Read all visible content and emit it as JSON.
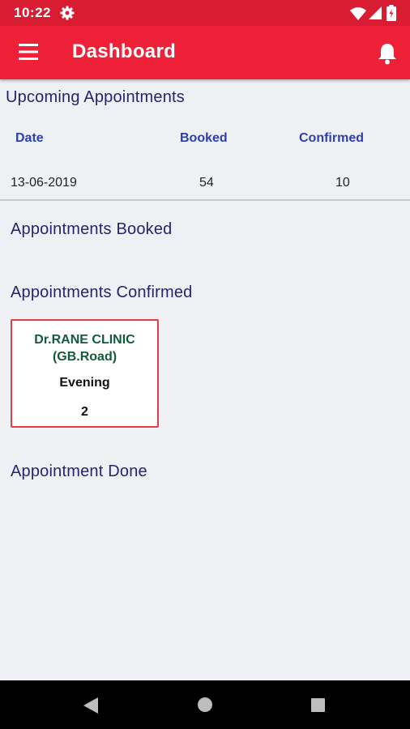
{
  "status_bar": {
    "time": "10:22"
  },
  "app_bar": {
    "title": "Dashboard"
  },
  "upcoming": {
    "title": "Upcoming Appointments",
    "columns": [
      "Date",
      "Booked",
      "Confirmed"
    ],
    "row": {
      "date": "13-06-2019",
      "booked": "54",
      "confirmed": "10"
    }
  },
  "sections": {
    "booked_title": "Appointments Booked",
    "confirmed_title": "Appointments Confirmed",
    "done_title": "Appointment Done"
  },
  "confirmed_card": {
    "clinic_line1": "Dr.RANE CLINIC",
    "clinic_line2": "(GB.Road)",
    "session": "Evening",
    "count": "2"
  },
  "colors": {
    "status_bar": "#d81d32",
    "app_bar": "#ef2139",
    "section_title": "#25256e",
    "column_header": "#2b3fae",
    "clinic_name": "#145a3c",
    "card_border": "#e23d4b"
  },
  "icons": {
    "status": [
      "gear-icon",
      "wifi-icon",
      "signal-icon",
      "battery-icon"
    ],
    "app_bar": [
      "menu-icon",
      "bell-icon"
    ],
    "nav": [
      "back-icon",
      "home-icon",
      "recents-icon"
    ]
  }
}
